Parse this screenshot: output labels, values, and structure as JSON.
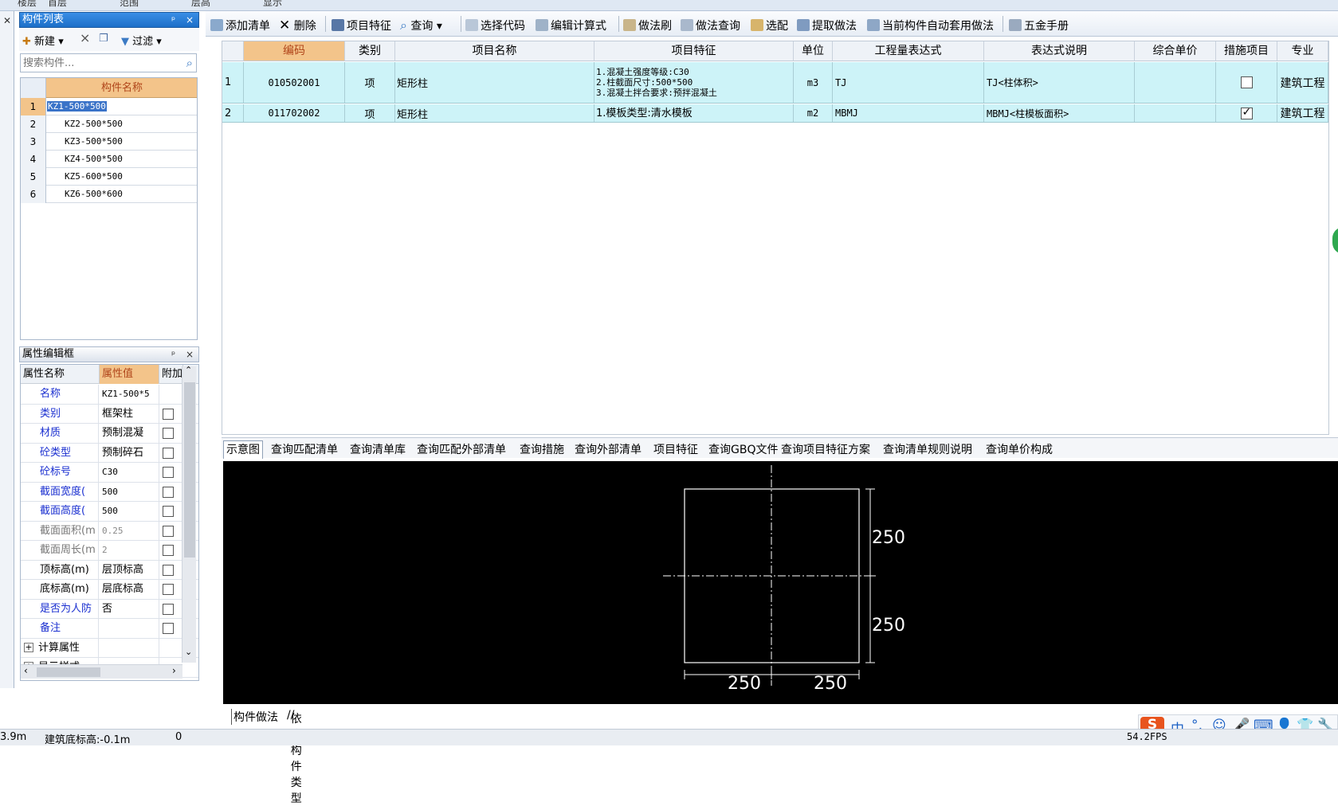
{
  "top_strip": [
    "楼层",
    "首层",
    "范围",
    "层高",
    "显示"
  ],
  "component_panel": {
    "title": "构件列表",
    "pin": "₽",
    "close": "×",
    "toolbar": {
      "new": "新建",
      "delete": "×",
      "copy": "复制",
      "filter": "过滤"
    },
    "search_placeholder": "搜索构件...",
    "column_header": "构件名称",
    "rows": [
      {
        "num": "1",
        "name": "KZ1-500*500"
      },
      {
        "num": "2",
        "name": "KZ2-500*500"
      },
      {
        "num": "3",
        "name": "KZ3-500*500"
      },
      {
        "num": "4",
        "name": "KZ4-500*500"
      },
      {
        "num": "5",
        "name": "KZ5-600*500"
      },
      {
        "num": "6",
        "name": "KZ6-500*600"
      }
    ],
    "selected_index": 0
  },
  "property_panel": {
    "title": "属性编辑框",
    "headers": {
      "name": "属性名称",
      "value": "属性值",
      "extra": "附加"
    },
    "rows": [
      {
        "name": "名称",
        "value": "KZ1-500*5",
        "style": "blue",
        "mono": true,
        "checkbox": false
      },
      {
        "name": "类别",
        "value": "框架柱",
        "style": "blue",
        "checkbox": true
      },
      {
        "name": "材质",
        "value": "预制混凝",
        "style": "blue",
        "checkbox": true
      },
      {
        "name": "砼类型",
        "value": "预制碎石",
        "style": "blue",
        "checkbox": true
      },
      {
        "name": "砼标号",
        "value": "C30",
        "style": "blue",
        "mono": true,
        "checkbox": true
      },
      {
        "name": "截面宽度(",
        "value": "500",
        "style": "blue",
        "mono": true,
        "checkbox": true
      },
      {
        "name": "截面高度(",
        "value": "500",
        "style": "blue",
        "mono": true,
        "checkbox": true
      },
      {
        "name": "截面面积(m",
        "value": "0.25",
        "style": "gray",
        "mono": true,
        "checkbox": true
      },
      {
        "name": "截面周长(m",
        "value": "2",
        "style": "gray",
        "mono": true,
        "checkbox": true
      },
      {
        "name": "顶标高(m)",
        "value": "层顶标高",
        "style": "black",
        "checkbox": true
      },
      {
        "name": "底标高(m)",
        "value": "层底标高",
        "style": "black",
        "checkbox": true
      },
      {
        "name": "是否为人防",
        "value": "否",
        "style": "blue",
        "checkbox": true
      },
      {
        "name": "备注",
        "value": "",
        "style": "blue",
        "checkbox": true
      },
      {
        "name": "计算属性",
        "value": "",
        "style": "black",
        "checkbox": false,
        "expander": "+"
      },
      {
        "name": "显示样式",
        "value": "",
        "style": "black",
        "checkbox": false,
        "expander": "+"
      }
    ]
  },
  "main_toolbar": [
    {
      "id": "add-bill",
      "label": "添加清单",
      "icon": "add-bill-icon"
    },
    {
      "id": "delete",
      "label": "删除",
      "icon": "delete-icon"
    },
    {
      "id": "item-feature",
      "label": "项目特征",
      "icon": "feature-icon"
    },
    {
      "id": "query",
      "label": "查询",
      "icon": "search-icon"
    },
    {
      "id": "select-code",
      "label": "选择代码",
      "icon": "code-icon"
    },
    {
      "id": "edit-formula",
      "label": "编辑计算式",
      "icon": "formula-icon"
    },
    {
      "id": "method-brush",
      "label": "做法刷",
      "icon": "brush-icon"
    },
    {
      "id": "method-query",
      "label": "做法查询",
      "icon": "method-query-icon"
    },
    {
      "id": "pick",
      "label": "选配",
      "icon": "pick-icon"
    },
    {
      "id": "extract",
      "label": "提取做法",
      "icon": "extract-icon"
    },
    {
      "id": "auto-apply",
      "label": "当前构件自动套用做法",
      "icon": "auto-apply-icon"
    },
    {
      "id": "hardware",
      "label": "五金手册",
      "icon": "manual-icon"
    }
  ],
  "bill_table": {
    "headers": [
      "编码",
      "类别",
      "项目名称",
      "项目特征",
      "单位",
      "工程量表达式",
      "表达式说明",
      "综合单价",
      "措施项目",
      "专业"
    ],
    "rows": [
      {
        "num": "1",
        "code": "010502001",
        "type": "项",
        "name": "矩形柱",
        "features": [
          "1.混凝土强度等级:C30",
          "2.柱截面尺寸:500*500",
          "3.混凝土拌合要求:预拌混凝土"
        ],
        "unit": "m3",
        "expr": "TJ",
        "expr_desc": "TJ<柱体积>",
        "unit_price": "",
        "measure": false,
        "specialty": "建筑工程"
      },
      {
        "num": "2",
        "code": "011702002",
        "type": "项",
        "name": "矩形柱",
        "features": [
          "1.模板类型:清水模板"
        ],
        "unit": "m2",
        "expr": "MBMJ",
        "expr_desc": "MBMJ<柱模板面积>",
        "unit_price": "",
        "measure": true,
        "specialty": "建筑工程"
      }
    ]
  },
  "query_tabs": [
    "示意图",
    "查询匹配清单",
    "查询清单库",
    "查询匹配外部清单",
    "查询措施",
    "查询外部清单",
    "项目特征",
    "查询GBQ文件",
    "查询项目特征方案",
    "查询清单规则说明",
    "查询单价构成"
  ],
  "drawing": {
    "dim_h_top": "250",
    "dim_h_bottom": "250",
    "dim_w_left": "250",
    "dim_w_right": "250"
  },
  "bottom_tabs": [
    "构件做法",
    "依附构件类型"
  ],
  "status": {
    "left": "3.9m",
    "elev": "建筑底标高:-0.1m",
    "zero": "0",
    "fps": "54.2FPS"
  },
  "ime": {
    "lang": "中",
    "items": [
      "°,",
      "☺",
      "🎤",
      "⌨",
      "👤",
      "👕",
      "🔧"
    ]
  }
}
